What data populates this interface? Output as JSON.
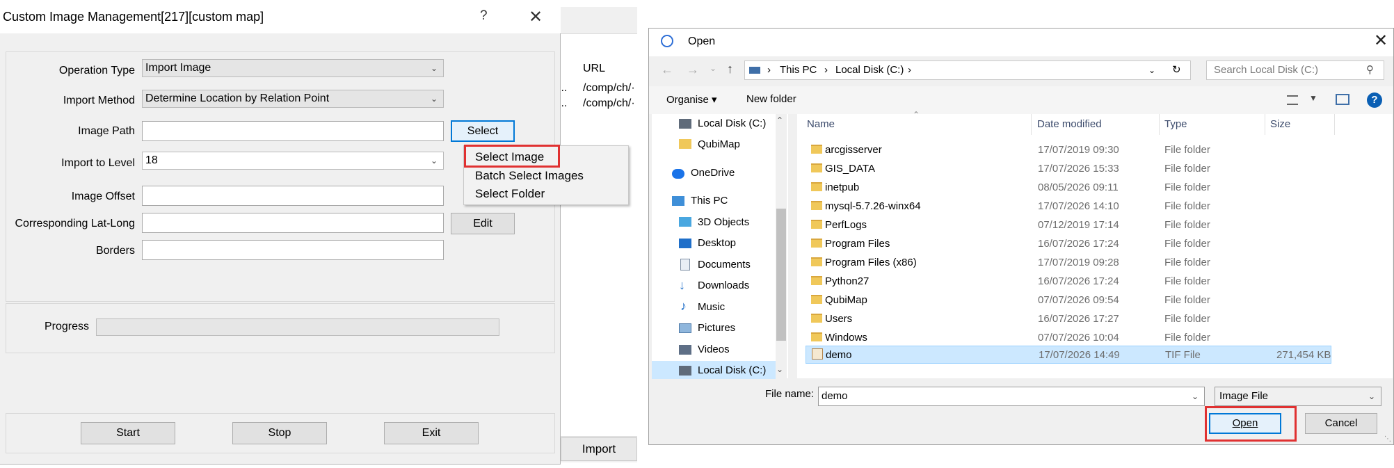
{
  "bg_window": {
    "url_header": "URL",
    "row1_left": "...",
    "row1_url": "/comp/ch/·",
    "row2_left": "...",
    "row2_url": "/comp/ch/·",
    "import_label": "Import"
  },
  "import_dialog": {
    "title": "Custom Image Management[217][custom map]",
    "help": "?",
    "close": "✕",
    "fields": {
      "operation_type_label": "Operation Type",
      "operation_type_value": "Import Image",
      "import_method_label": "Import Method",
      "import_method_value": "Determine Location by Relation Point",
      "image_path_label": "Image Path",
      "image_path_value": "",
      "import_level_label": "Import to Level",
      "import_level_value": "18",
      "image_offset_label": "Image Offset",
      "image_offset_value": "",
      "lat_long_label": "Corresponding Lat-Long",
      "lat_long_value": "",
      "borders_label": "Borders",
      "borders_value": ""
    },
    "select_label": "Select",
    "edit_label": "Edit",
    "menu": {
      "select_image": "Select Image",
      "batch_select": "Batch Select Images",
      "select_folder": "Select Folder"
    },
    "progress_label": "Progress",
    "progress": 0,
    "start_label": "Start",
    "stop_label": "Stop",
    "exit_label": "Exit"
  },
  "open_dialog": {
    "title": "Open",
    "close": "✕",
    "breadcrumb": {
      "this_pc": "This PC",
      "local_disk": "Local Disk (C:)"
    },
    "search_placeholder": "Search Local Disk (C:)",
    "organise_label": "Organise ▾",
    "new_folder_label": "New folder",
    "help": "?",
    "nav": {
      "local_disk": "Local Disk (C:)",
      "qubimap": "QubiMap",
      "onedrive": "OneDrive",
      "this_pc": "This PC",
      "objects": "3D Objects",
      "desktop": "Desktop",
      "documents": "Documents",
      "downloads": "Downloads",
      "music": "Music",
      "pictures": "Pictures",
      "videos": "Videos",
      "local_disk_2": "Local Disk (C:)"
    },
    "columns": {
      "name": "Name",
      "date": "Date modified",
      "type": "Type",
      "size": "Size"
    },
    "files": [
      {
        "name": "arcgisserver",
        "date": "17/07/2019 09:30",
        "type": "File folder",
        "size": ""
      },
      {
        "name": "GIS_DATA",
        "date": "17/07/2026 15:33",
        "type": "File folder",
        "size": ""
      },
      {
        "name": "inetpub",
        "date": "08/05/2026 09:11",
        "type": "File folder",
        "size": ""
      },
      {
        "name": "mysql-5.7.26-winx64",
        "date": "17/07/2026 14:10",
        "type": "File folder",
        "size": ""
      },
      {
        "name": "PerfLogs",
        "date": "07/12/2019 17:14",
        "type": "File folder",
        "size": ""
      },
      {
        "name": "Program Files",
        "date": "16/07/2026 17:24",
        "type": "File folder",
        "size": ""
      },
      {
        "name": "Program Files (x86)",
        "date": "17/07/2019 09:28",
        "type": "File folder",
        "size": ""
      },
      {
        "name": "Python27",
        "date": "16/07/2026 17:24",
        "type": "File folder",
        "size": ""
      },
      {
        "name": "QubiMap",
        "date": "07/07/2026 09:54",
        "type": "File folder",
        "size": ""
      },
      {
        "name": "Users",
        "date": "16/07/2026 17:27",
        "type": "File folder",
        "size": ""
      },
      {
        "name": "Windows",
        "date": "07/07/2026 10:04",
        "type": "File folder",
        "size": ""
      },
      {
        "name": "demo",
        "date": "17/07/2026 14:49",
        "type": "TIF File",
        "size": "271,454 KB"
      }
    ],
    "file_name_label": "File name:",
    "file_name_value": "demo",
    "file_type_value": "Image File",
    "open_label": "Open",
    "cancel_label": "Cancel"
  },
  "colors": {
    "accent": "#0078d7",
    "highlight_box": "#e03131",
    "selection": "#cce8ff"
  }
}
